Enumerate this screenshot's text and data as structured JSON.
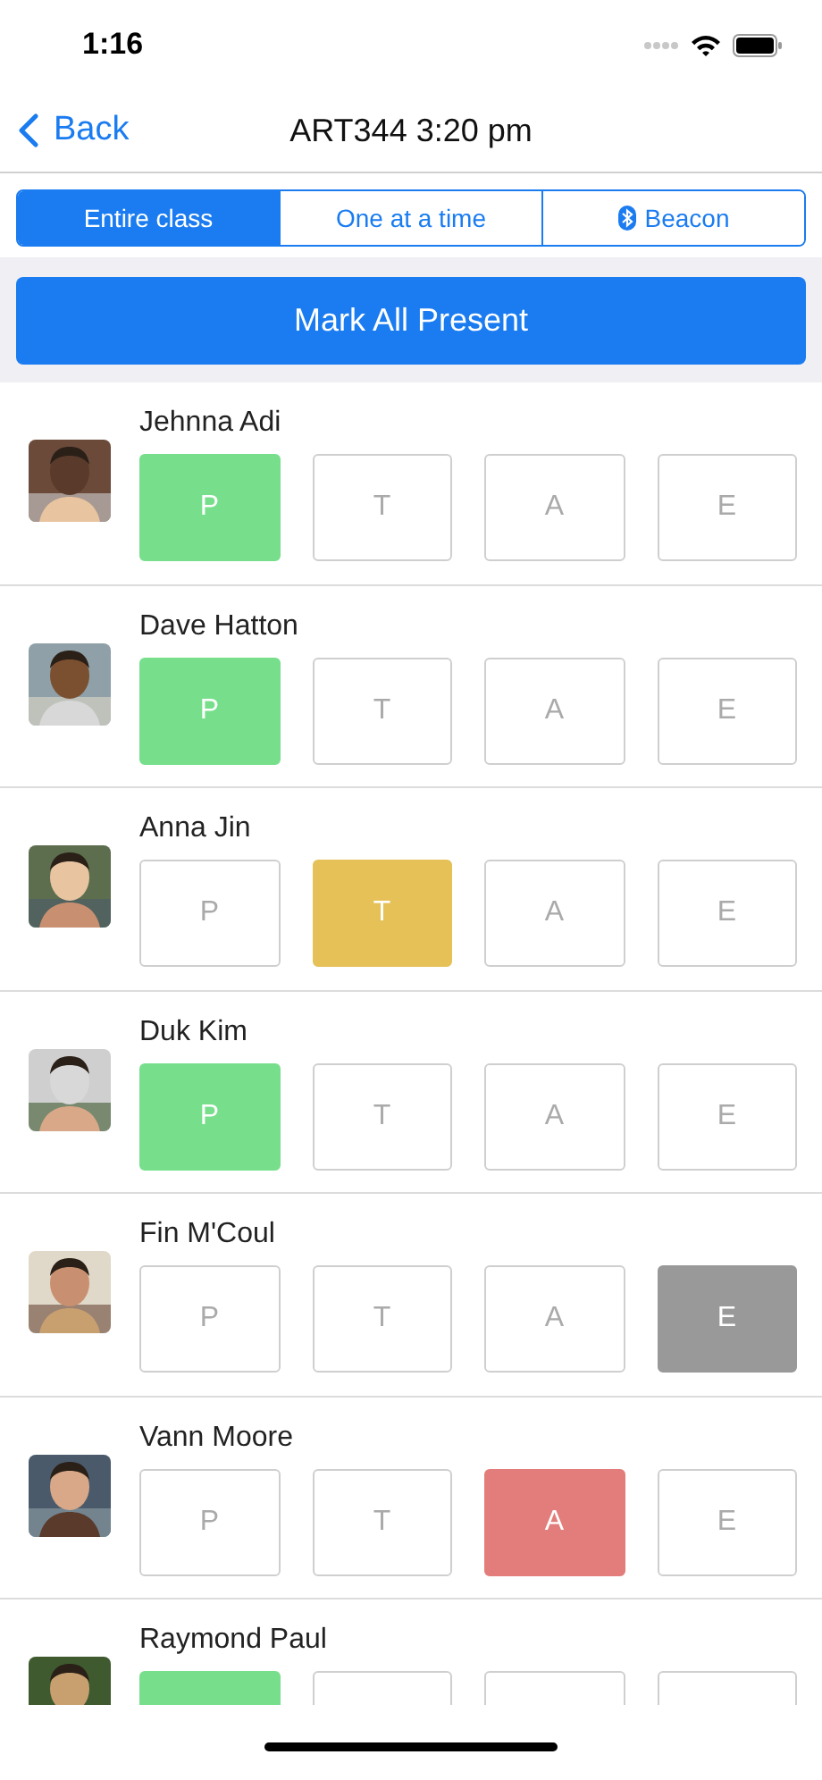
{
  "status_bar": {
    "time": "1:16"
  },
  "nav": {
    "back": "Back",
    "title": "ART344 3:20 pm"
  },
  "tabs": [
    {
      "label": "Entire class",
      "selected": true,
      "kind": "plain"
    },
    {
      "label": "One at a time",
      "selected": false,
      "kind": "plain"
    },
    {
      "label": "Beacon",
      "selected": false,
      "kind": "bluetooth"
    }
  ],
  "mark_all_button": "Mark All Present",
  "students": [
    {
      "name": "Jehnna Adi",
      "marks": [
        {
          "label": "P",
          "selected": true,
          "kind": "present"
        },
        {
          "label": "T",
          "selected": false,
          "kind": "tardy"
        },
        {
          "label": "A",
          "selected": false,
          "kind": "absent"
        },
        {
          "label": "E",
          "selected": false,
          "kind": "excused"
        }
      ]
    },
    {
      "name": "Dave Hatton",
      "marks": [
        {
          "label": "P",
          "selected": true,
          "kind": "present"
        },
        {
          "label": "T",
          "selected": false,
          "kind": "tardy"
        },
        {
          "label": "A",
          "selected": false,
          "kind": "absent"
        },
        {
          "label": "E",
          "selected": false,
          "kind": "excused"
        }
      ]
    },
    {
      "name": "Anna Jin",
      "marks": [
        {
          "label": "P",
          "selected": false,
          "kind": "present"
        },
        {
          "label": "T",
          "selected": true,
          "kind": "tardy"
        },
        {
          "label": "A",
          "selected": false,
          "kind": "absent"
        },
        {
          "label": "E",
          "selected": false,
          "kind": "excused"
        }
      ]
    },
    {
      "name": "Duk Kim",
      "marks": [
        {
          "label": "P",
          "selected": true,
          "kind": "present"
        },
        {
          "label": "T",
          "selected": false,
          "kind": "tardy"
        },
        {
          "label": "A",
          "selected": false,
          "kind": "absent"
        },
        {
          "label": "E",
          "selected": false,
          "kind": "excused"
        }
      ]
    },
    {
      "name": "Fin M'Coul",
      "marks": [
        {
          "label": "P",
          "selected": false,
          "kind": "present"
        },
        {
          "label": "T",
          "selected": false,
          "kind": "tardy"
        },
        {
          "label": "A",
          "selected": false,
          "kind": "absent"
        },
        {
          "label": "E",
          "selected": true,
          "kind": "excused"
        }
      ]
    },
    {
      "name": "Vann Moore",
      "marks": [
        {
          "label": "P",
          "selected": false,
          "kind": "present"
        },
        {
          "label": "T",
          "selected": false,
          "kind": "tardy"
        },
        {
          "label": "A",
          "selected": true,
          "kind": "absent"
        },
        {
          "label": "E",
          "selected": false,
          "kind": "excused"
        }
      ]
    },
    {
      "name": "Raymond Paul",
      "marks": [
        {
          "selected": true,
          "kind": "present"
        },
        {
          "selected": false,
          "kind": "tardy"
        },
        {
          "selected": false,
          "kind": "absent"
        },
        {
          "selected": false,
          "kind": "excused"
        }
      ]
    }
  ]
}
